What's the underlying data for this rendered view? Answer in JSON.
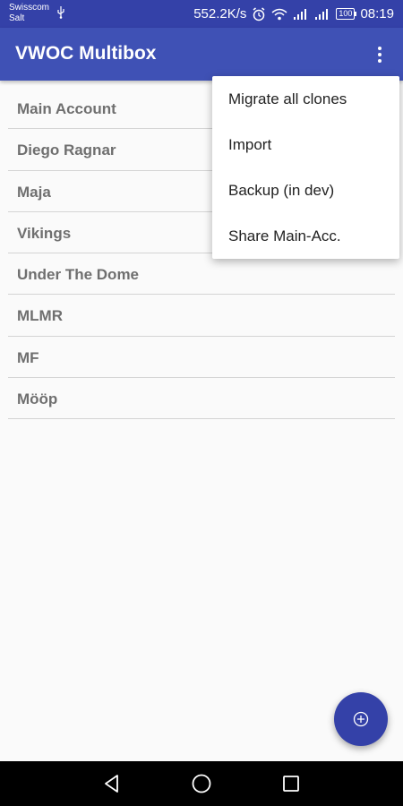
{
  "status_bar": {
    "carrier_line1": "Swisscom",
    "carrier_line2": "Salt",
    "speed": "552.2K/s",
    "battery": "100",
    "time": "08:19"
  },
  "app_bar": {
    "title": "VWOC Multibox"
  },
  "accounts": [
    {
      "name": "Main Account"
    },
    {
      "name": "Diego Ragnar"
    },
    {
      "name": "Maja"
    },
    {
      "name": "Vikings"
    },
    {
      "name": "Under The Dome"
    },
    {
      "name": "MLMR"
    },
    {
      "name": "MF"
    },
    {
      "name": "Mööp"
    }
  ],
  "menu": {
    "items": [
      {
        "label": "Migrate all clones"
      },
      {
        "label": "Import"
      },
      {
        "label": "Backup (in dev)"
      },
      {
        "label": "Share Main-Acc."
      }
    ]
  },
  "colors": {
    "app_bar": "#3f51b5",
    "status_bar": "#3441a8",
    "fab": "#3441a8",
    "list_text": "#6f6f6f"
  },
  "icons": {
    "fab": "add-circle-icon",
    "overflow": "more-vert-icon",
    "nav_back": "back-triangle-icon",
    "nav_home": "home-circle-icon",
    "nav_recent": "recents-square-icon"
  }
}
